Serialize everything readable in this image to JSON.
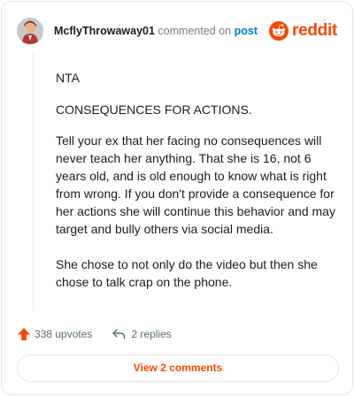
{
  "header": {
    "username": "McflyThrowaway01",
    "commented_text": "commented on",
    "post_link": "post"
  },
  "brand": {
    "name": "reddit",
    "color": "#ff4500",
    "icon": "reddit-alien-icon"
  },
  "comment": {
    "paragraphs": [
      "NTA",
      "CONSEQUENCES FOR ACTIONS.",
      "Tell your ex that her facing no consequences will never teach her anything. That she is 16, not 6 years old, and is old enough to know what is right from wrong. If you don't provide a consequence for her actions she will continue this behavior and may target and bully others via social media.",
      "She chose to not only do the video but then she chose to talk crap on the phone."
    ]
  },
  "actions": {
    "upvotes_label": "338 upvotes",
    "replies_label": "2 replies",
    "upvote_icon": "upvote-arrow-icon",
    "reply_icon": "reply-arrow-icon"
  },
  "footer": {
    "view_comments_label": "View 2 comments"
  },
  "colors": {
    "accent": "#ff4500",
    "link": "#0079d3",
    "muted": "#576f76"
  }
}
